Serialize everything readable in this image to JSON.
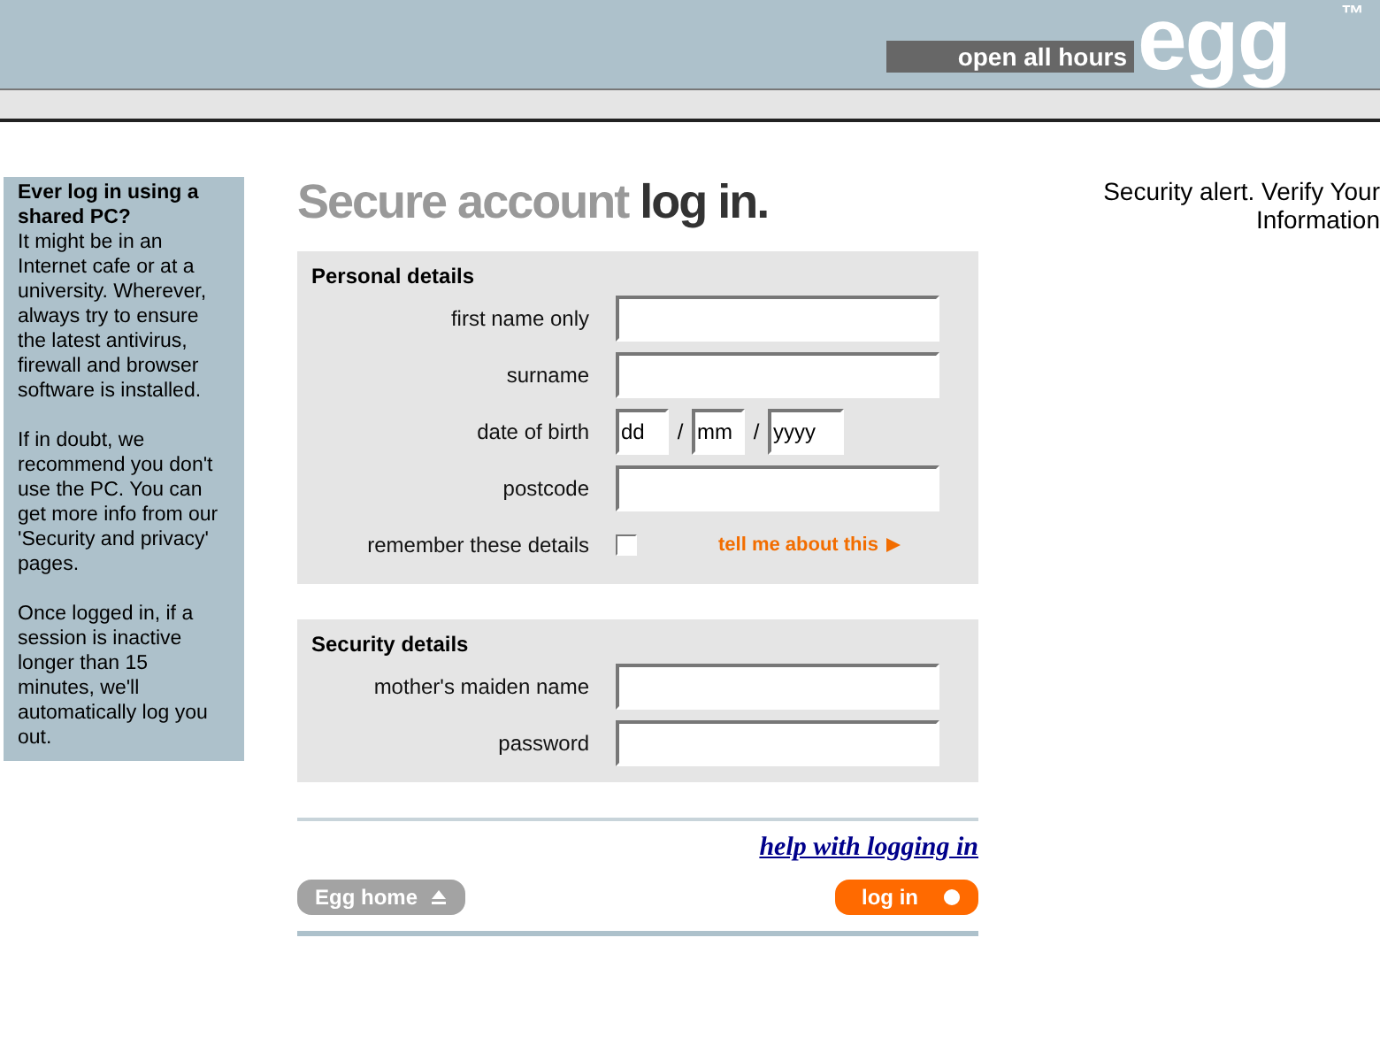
{
  "header": {
    "tagline": "open all hours",
    "logo": "egg",
    "trademark": "™"
  },
  "sidebar": {
    "heading": "Ever log in using a shared PC?",
    "paragraphs": [
      "It might be in an Internet cafe or at a university. Wherever, always try to ensure the latest antivirus, firewall and browser software is installed.",
      "If in doubt, we recommend you don't use the PC. You can get more info from our 'Security and privacy' pages.",
      "Once logged in, if a session is inactive longer than 15 minutes, we'll automatically log you out."
    ]
  },
  "title": {
    "lead": "Secure account",
    "emphasis": "log in."
  },
  "sections": [
    {
      "heading": "Personal details",
      "rows": [
        {
          "kind": "text",
          "label": "first name only"
        },
        {
          "kind": "text",
          "label": "surname"
        },
        {
          "kind": "date",
          "label": "date of birth",
          "parts": [
            {
              "value": "dd",
              "separator": "/"
            },
            {
              "value": "mm",
              "separator": "/"
            },
            {
              "value": "yyyy"
            }
          ]
        },
        {
          "kind": "text",
          "label": "postcode"
        },
        {
          "kind": "checkbox",
          "label": "remember these details",
          "checked": false,
          "link": "tell me about this"
        }
      ]
    },
    {
      "heading": "Security details",
      "rows": [
        {
          "kind": "text",
          "label": "mother's maiden name"
        },
        {
          "kind": "password",
          "label": "password"
        }
      ]
    }
  ],
  "help_link": "help with logging in",
  "buttons": [
    {
      "kind": "home",
      "label": "Egg home"
    },
    {
      "kind": "submit",
      "label": "log in"
    }
  ],
  "alert": "Security alert. Verify Your Information"
}
